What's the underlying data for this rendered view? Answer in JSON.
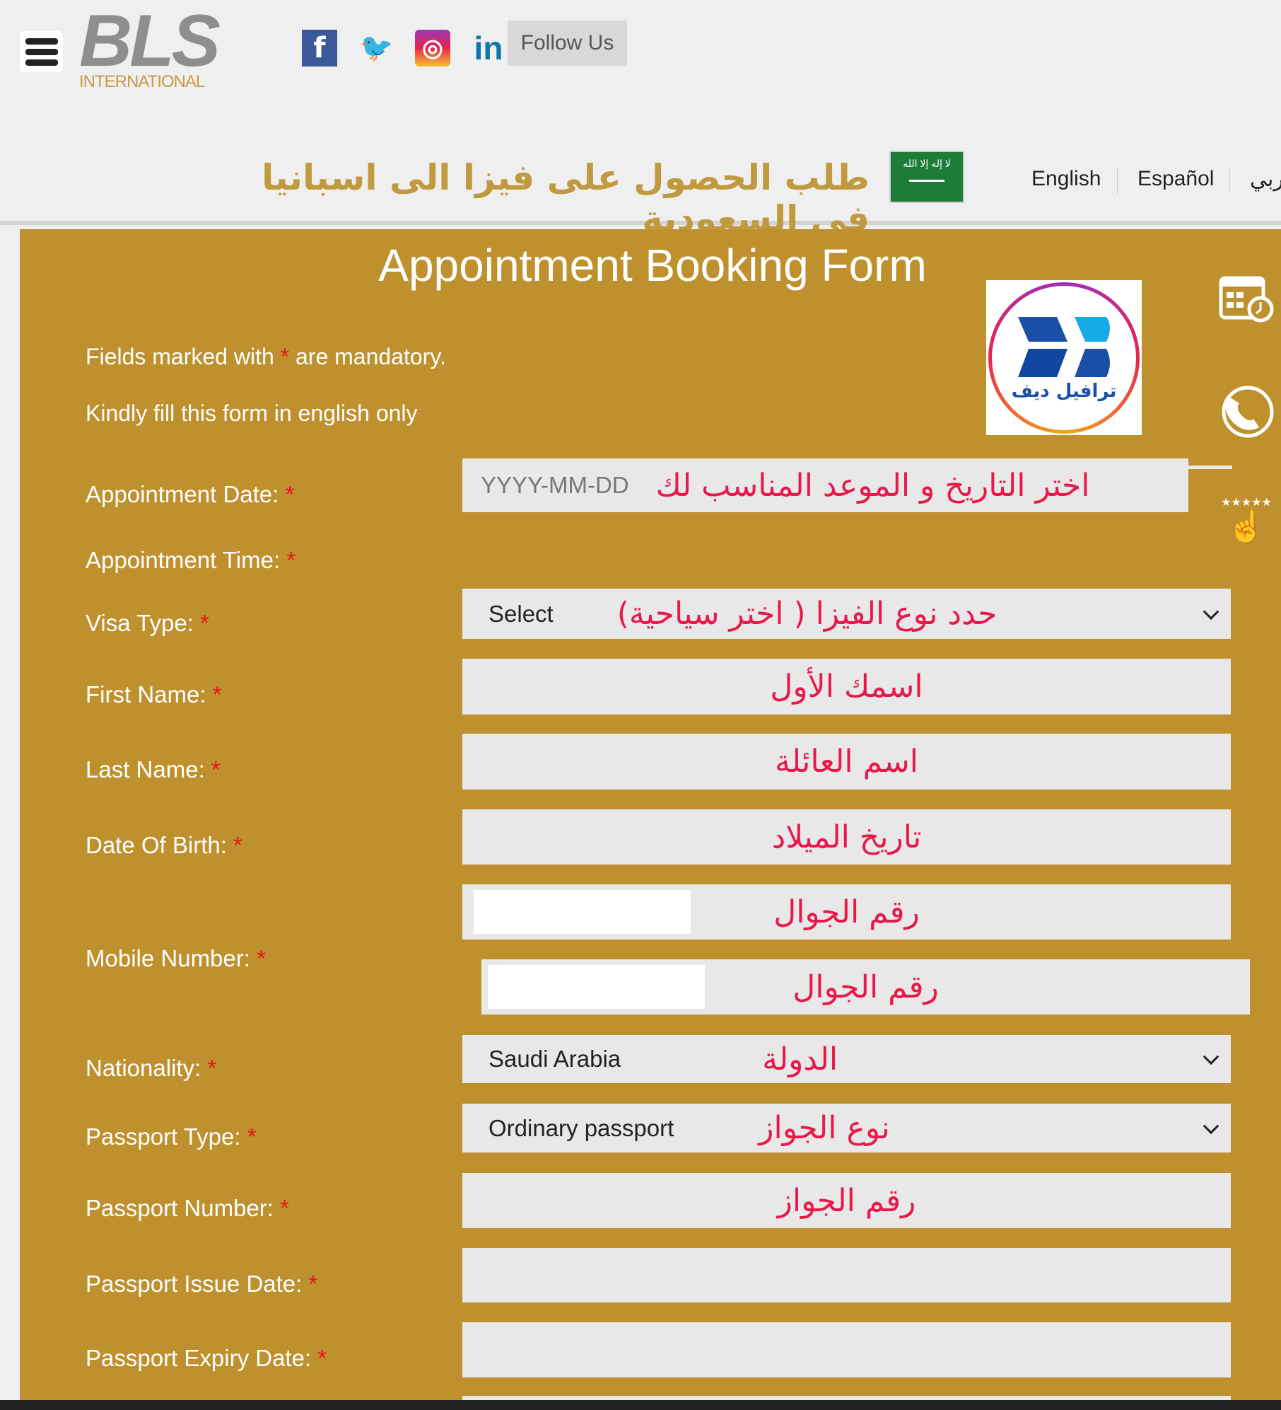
{
  "header": {
    "logo_text": "BLS",
    "logo_subtext": "INTERNATIONAL",
    "social": [
      {
        "name": "facebook",
        "glyph": "f",
        "color": "#3b5998"
      },
      {
        "name": "twitter",
        "glyph": "🐦",
        "color": "#1da1f2"
      },
      {
        "name": "instagram",
        "glyph": "◎",
        "color": "#d6306a"
      },
      {
        "name": "linkedin",
        "glyph": "in",
        "color": "#0e76a8"
      }
    ],
    "follow_us": "Follow Us",
    "arabic_title": "طلب الحصول على فيزا الى اسبانيا في السعودية",
    "flag_text": "لا إله إلا الله",
    "languages": [
      "English",
      "Español",
      "عربي"
    ]
  },
  "form": {
    "title": "Appointment Booking Form",
    "mandatory_note_before": "Fields marked with ",
    "asterisk": "*",
    "mandatory_note_after": " are mandatory.",
    "english_note": "Kindly fill this form in english only",
    "labels": {
      "appointment_date": "Appointment Date:",
      "appointment_time": "Appointment Time:",
      "visa_type": "Visa Type:",
      "first_name": "First Name:",
      "last_name": "Last Name:",
      "date_of_birth": "Date Of Birth:",
      "mobile_number": "Mobile Number:",
      "nationality": "Nationality:",
      "passport_type": "Passport Type:",
      "passport_number": "Passport Number:",
      "passport_issue_date": "Passport Issue Date:",
      "passport_expiry_date": "Passport Expiry Date:"
    },
    "appointment_date_placeholder": "YYYY-MM-DD",
    "visa_type_value": "Select",
    "nationality_value": "Saudi Arabia",
    "passport_type_value": "Ordinary passport"
  },
  "annotations": {
    "appointment_date": "اختر التاريخ و الموعد المناسب لك",
    "visa_type": "حدد نوع الفيزا ( اختر سياحية)",
    "first_name": "اسمك الأول",
    "last_name": "اسم العائلة",
    "date_of_birth": "تاريخ الميلاد",
    "mobile1": "رقم الجوال",
    "mobile2": "رقم الجوال",
    "nationality": "الدولة",
    "passport_type": "نوع الجواز",
    "passport_number": "رقم الجواز"
  },
  "promo_logo_text": "ترافيل ديف",
  "side_icons": [
    "calendar-clock-icon",
    "phone-icon",
    "rating-hand-icon"
  ],
  "side_stars": "★★★★★",
  "colors": {
    "panel": "#be902e",
    "annotation": "#e8194a",
    "title_gold": "#c19a3f"
  }
}
